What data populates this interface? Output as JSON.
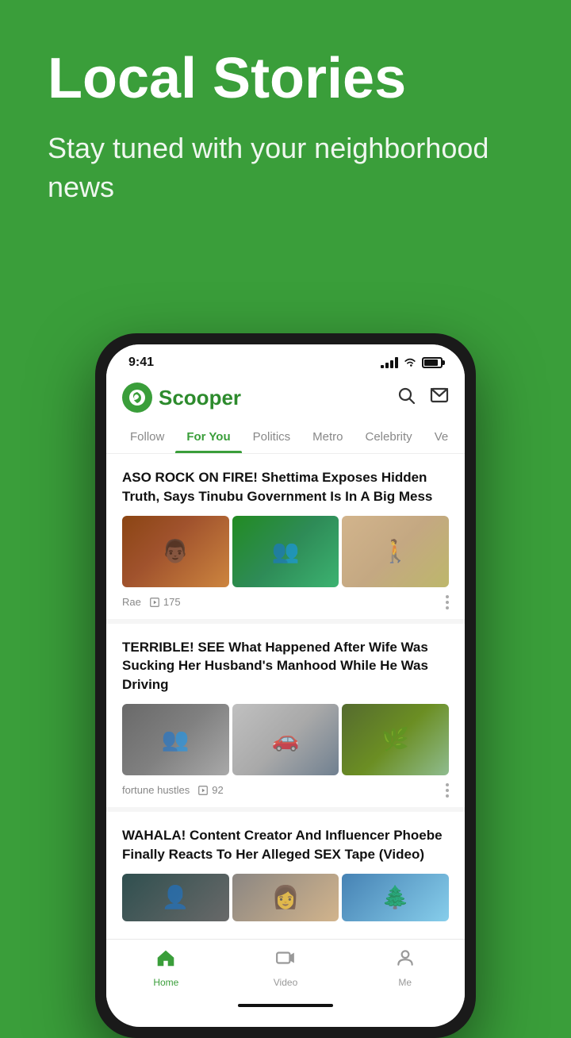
{
  "hero": {
    "title": "Local Stories",
    "subtitle": "Stay tuned with your neighborhood news"
  },
  "status_bar": {
    "time": "9:41"
  },
  "header": {
    "logo_text": "Scooper",
    "search_label": "search",
    "mail_label": "mail"
  },
  "tabs": [
    {
      "id": "follow",
      "label": "Follow",
      "active": false
    },
    {
      "id": "for-you",
      "label": "For You",
      "active": true
    },
    {
      "id": "politics",
      "label": "Politics",
      "active": false
    },
    {
      "id": "metro",
      "label": "Metro",
      "active": false
    },
    {
      "id": "celebrity",
      "label": "Celebrity",
      "active": false
    },
    {
      "id": "ve",
      "label": "Ve",
      "active": false
    }
  ],
  "articles": [
    {
      "id": "article-1",
      "title": "ASO ROCK ON FIRE! Shettima Exposes Hidden Truth, Says Tinubu Government Is In A Big Mess",
      "author": "Rae",
      "views": "175",
      "images": [
        "person-meeting",
        "government-meeting",
        "walking-figure"
      ]
    },
    {
      "id": "article-2",
      "title": "TERRIBLE! SEE What Happened After Wife Was Sucking Her Husband's Manhood While He Was Driving",
      "author": "fortune hustles",
      "views": "92",
      "images": [
        "crowd-scene",
        "car-accident",
        "group-outdoors"
      ]
    },
    {
      "id": "article-3",
      "title": "WAHALA! Content Creator And Influencer Phoebe Finally Reacts To Her Alleged SEX Tape (Video)",
      "author": "",
      "views": "",
      "images": [
        "person-dark",
        "person-light",
        "person-outdoor"
      ]
    }
  ],
  "bottom_nav": [
    {
      "id": "home",
      "label": "Home",
      "active": true,
      "icon": "🏠"
    },
    {
      "id": "video",
      "label": "Video",
      "active": false,
      "icon": "📺"
    },
    {
      "id": "me",
      "label": "Me",
      "active": false,
      "icon": "👤"
    }
  ]
}
